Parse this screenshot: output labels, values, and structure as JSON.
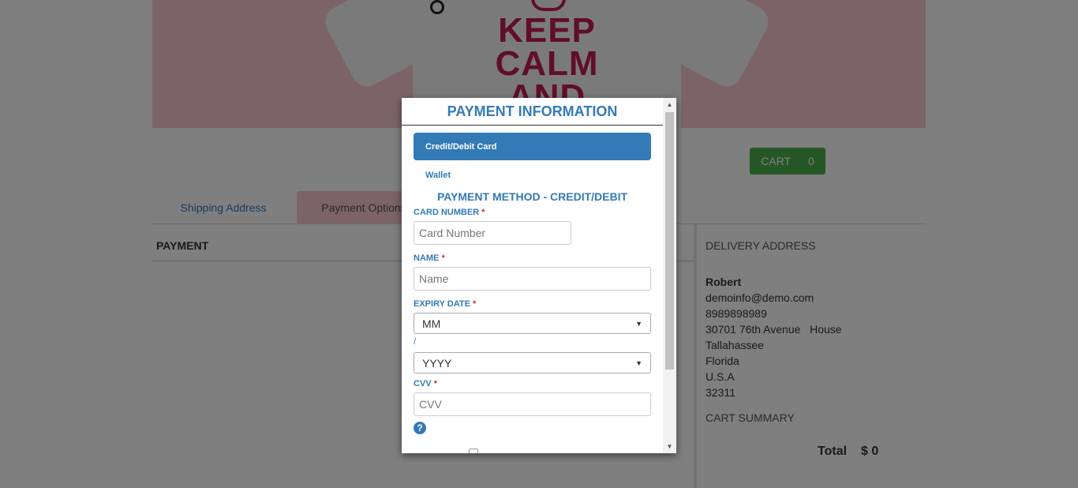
{
  "banner": {
    "shirt_lines": [
      "KEEP",
      "CALM",
      "AND"
    ]
  },
  "cart": {
    "label": "CART",
    "count": "0"
  },
  "tabs": [
    {
      "label": "Shipping Address"
    },
    {
      "label": "Payment Options"
    }
  ],
  "payment": {
    "heading": "PAYMENT"
  },
  "delivery": {
    "title": "DELIVERY ADDRESS",
    "name": "Robert",
    "email": "demoinfo@demo.com",
    "phone": "8989898989",
    "street": "30701 76th Avenue   House",
    "city": "Tallahassee",
    "state": "Florida",
    "country": "U.S.A",
    "zip": "32311"
  },
  "cart_summary": {
    "title": "CART SUMMARY",
    "total_label": "Total",
    "total_value": "$ 0"
  },
  "modal": {
    "title": "PAYMENT INFORMATION",
    "methods": {
      "active": "Credit/Debit Card",
      "other": "Wallet"
    },
    "section_title": "PAYMENT METHOD - CREDIT/DEBIT",
    "card_number": {
      "label": "CARD NUMBER",
      "placeholder": "Card Number"
    },
    "name": {
      "label": "NAME",
      "placeholder": "Name"
    },
    "expiry": {
      "label": "EXPIRY DATE",
      "month_value": "MM",
      "separator": "/",
      "year_value": "YYYY"
    },
    "cvv": {
      "label": "CVV",
      "placeholder": "CVV"
    },
    "required_mark": "*",
    "help_glyph": "?"
  },
  "colors": {
    "primary": "#337ab7",
    "cart_green": "#4cae4c",
    "banner_pink": "#f7c6d0",
    "shirt_text": "#c21d57",
    "required": "#c9302c"
  }
}
